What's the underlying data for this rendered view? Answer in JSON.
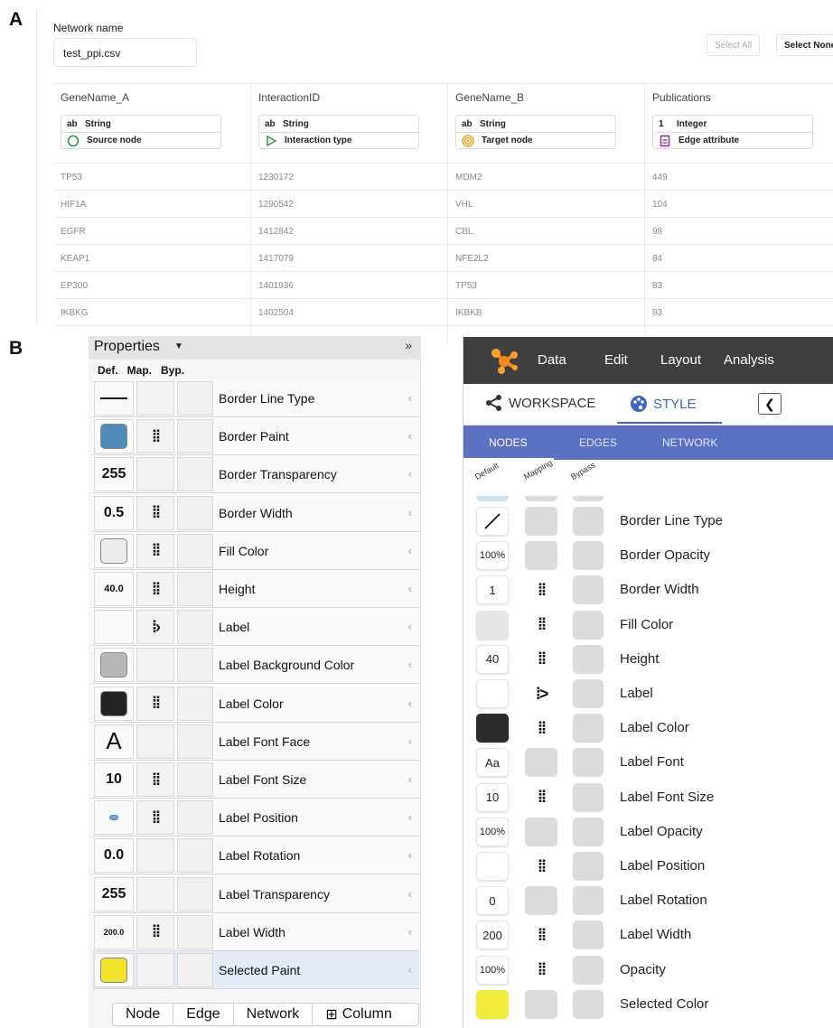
{
  "panel_a": {
    "letter": "A",
    "network_name_label": "Network name",
    "network_name_value": "test_ppi.csv",
    "select_all": "Select All",
    "select_none": "Select None",
    "columns": [
      {
        "name": "GeneName_A",
        "type_code": "ab",
        "type": "String",
        "role": "Source node",
        "role_icon": "circle-outline-icon",
        "icon_color": "#2e9a45"
      },
      {
        "name": "InteractionID",
        "type_code": "ab",
        "type": "String",
        "role": "Interaction type",
        "role_icon": "play-outline-icon",
        "icon_color": "#2e9a45"
      },
      {
        "name": "GeneName_B",
        "type_code": "ab",
        "type": "String",
        "role": "Target node",
        "role_icon": "target-icon",
        "icon_color": "#f0a020"
      },
      {
        "name": "Publications",
        "type_code": "1",
        "type": "Integer",
        "role": "Edge attribute",
        "role_icon": "document-icon",
        "icon_color": "#8a2a9a"
      }
    ],
    "rows": [
      [
        "TP53",
        "1230172",
        "MDM2",
        "449"
      ],
      [
        "HIF1A",
        "1290542",
        "VHL",
        "104"
      ],
      [
        "EGFR",
        "1412842",
        "CBL",
        "98"
      ],
      [
        "KEAP1",
        "1417079",
        "NFE2L2",
        "84"
      ],
      [
        "EP300",
        "1401936",
        "TP53",
        "83"
      ],
      [
        "IKBKG",
        "1402504",
        "IKBKB",
        "83"
      ]
    ]
  },
  "panel_b_letter": "B",
  "desktop": {
    "title": "Properties",
    "col_def": "Def.",
    "col_map": "Map.",
    "col_byp": "Byp.",
    "properties": [
      {
        "label": "Border Line Type",
        "def_kind": "line",
        "map": ""
      },
      {
        "label": "Border Paint",
        "def_kind": "swatch",
        "color": "#4f8db8",
        "map": "dots"
      },
      {
        "label": "Border Transparency",
        "def_kind": "text",
        "value": "255",
        "map": ""
      },
      {
        "label": "Border Width",
        "def_kind": "text",
        "value": "0.5",
        "map": "dots"
      },
      {
        "label": "Fill Color",
        "def_kind": "swatch",
        "color": "#ececec",
        "map": "dots"
      },
      {
        "label": "Height",
        "def_kind": "text-sm",
        "value": "40.0",
        "map": "dots"
      },
      {
        "label": "Label",
        "def_kind": "empty",
        "map": "passthrough"
      },
      {
        "label": "Label Background Color",
        "def_kind": "swatch",
        "color": "#b8b8b8",
        "map": ""
      },
      {
        "label": "Label Color",
        "def_kind": "swatch",
        "color": "#222222",
        "map": "dots"
      },
      {
        "label": "Label Font Face",
        "def_kind": "big",
        "value": "A",
        "map": ""
      },
      {
        "label": "Label Font Size",
        "def_kind": "text",
        "value": "10",
        "map": "dots"
      },
      {
        "label": "Label Position",
        "def_kind": "position",
        "map": "dots"
      },
      {
        "label": "Label Rotation",
        "def_kind": "text",
        "value": "0.0",
        "map": ""
      },
      {
        "label": "Label Transparency",
        "def_kind": "text",
        "value": "255",
        "map": ""
      },
      {
        "label": "Label Width",
        "def_kind": "text-xs",
        "value": "200.0",
        "map": "dots"
      },
      {
        "label": "Selected Paint",
        "def_kind": "swatch",
        "color": "#f2e22a",
        "map": "",
        "selected": true
      }
    ],
    "tabs": [
      "Node",
      "Edge",
      "Network",
      "Column"
    ]
  },
  "web": {
    "menu": [
      "Data",
      "Edit",
      "Layout",
      "Analysis"
    ],
    "tab_workspace": "WORKSPACE",
    "tab_style": "STYLE",
    "subtabs": [
      "NODES",
      "EDGES",
      "NETWORK"
    ],
    "col_default": "Default",
    "col_mapping": "Mapping",
    "col_bypass": "Bypass",
    "accent": "#3d64c8",
    "properties": [
      {
        "label": "Border Line Type",
        "def_kind": "slash",
        "map": ""
      },
      {
        "label": "Border Opacity",
        "def_kind": "text",
        "value": "100%",
        "map": ""
      },
      {
        "label": "Border Width",
        "def_kind": "text",
        "value": "1",
        "map": "dots"
      },
      {
        "label": "Fill Color",
        "def_kind": "swatch",
        "color": "#e6e6e6",
        "map": "dots"
      },
      {
        "label": "Height",
        "def_kind": "text",
        "value": "40",
        "map": "dots"
      },
      {
        "label": "Label",
        "def_kind": "empty",
        "map": "passthrough"
      },
      {
        "label": "Label Color",
        "def_kind": "swatch",
        "color": "#2b2b2b",
        "map": "dots"
      },
      {
        "label": "Label Font",
        "def_kind": "text",
        "value": "Aa",
        "map": ""
      },
      {
        "label": "Label Font Size",
        "def_kind": "text",
        "value": "10",
        "map": "dots"
      },
      {
        "label": "Label Opacity",
        "def_kind": "text",
        "value": "100%",
        "map": ""
      },
      {
        "label": "Label Position",
        "def_kind": "empty",
        "map": "dots"
      },
      {
        "label": "Label Rotation",
        "def_kind": "text",
        "value": "0",
        "map": ""
      },
      {
        "label": "Label Width",
        "def_kind": "text",
        "value": "200",
        "map": "dots"
      },
      {
        "label": "Opacity",
        "def_kind": "text",
        "value": "100%",
        "map": "dots"
      },
      {
        "label": "Selected Color",
        "def_kind": "swatch",
        "color": "#f4ec3a",
        "map": ""
      }
    ]
  }
}
